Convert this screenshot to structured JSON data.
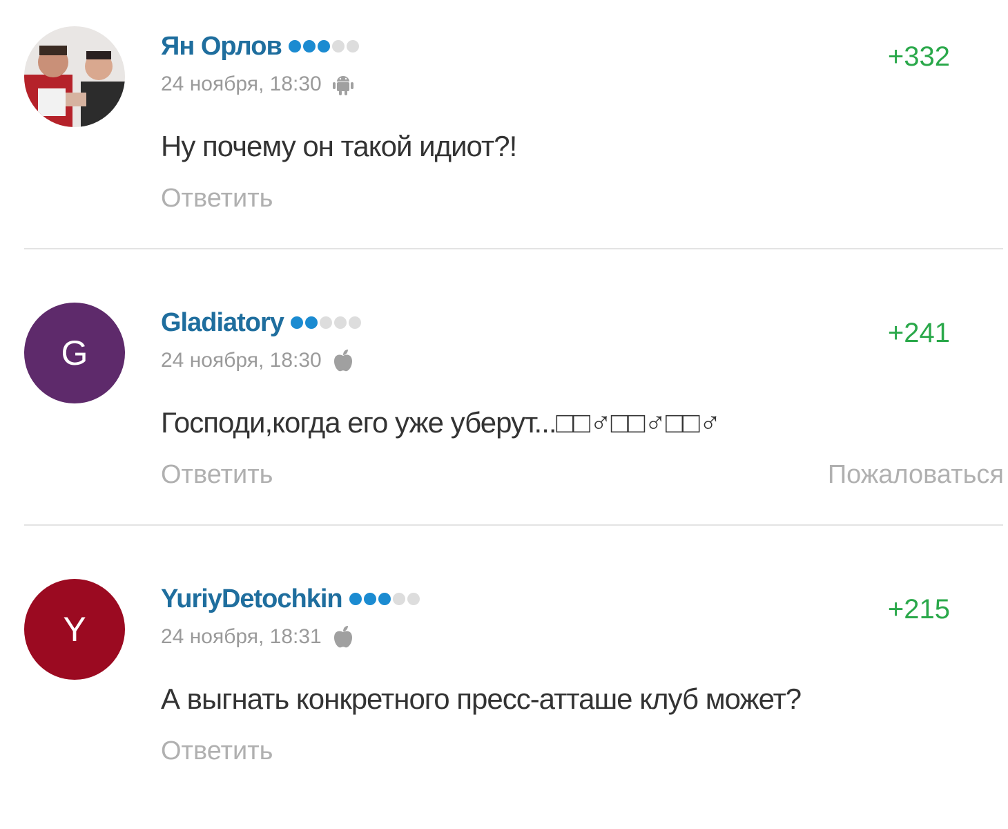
{
  "comments": [
    {
      "author": "Ян Орлов",
      "avatar_type": "photo",
      "rating_level": 3,
      "rating_max": 5,
      "date": "24 ноября, 18:30",
      "platform_icon": "android-icon",
      "score": "+332",
      "text": "Ну почему он такой идиот?!",
      "reply_label": "Ответить"
    },
    {
      "author": "Gladiatory",
      "avatar_letter": "G",
      "avatar_color": "#5e2a6b",
      "rating_level": 2,
      "rating_max": 5,
      "date": "24 ноября, 18:30",
      "platform_icon": "apple-icon",
      "score": "+241",
      "text": "Господи,когда его уже уберут...□□♂□□♂□□♂",
      "reply_label": "Ответить",
      "report_label": "Пожаловаться"
    },
    {
      "author": "YuriyDetochkin",
      "avatar_letter": "Y",
      "avatar_color": "#9b0a21",
      "rating_level": 3,
      "rating_max": 5,
      "date": "24 ноября, 18:31",
      "platform_icon": "apple-icon",
      "score": "+215",
      "text": "А выгнать конкретного пресс-атташе клуб может?",
      "reply_label": "Ответить"
    }
  ],
  "colors": {
    "author_link": "#1f6e9e",
    "rating_dot_on": "#1b8bd1",
    "rating_dot_off": "#dddddd",
    "score_positive": "#2aa84a",
    "muted_text": "#9a9a9a",
    "action_text": "#b0b0b0"
  }
}
